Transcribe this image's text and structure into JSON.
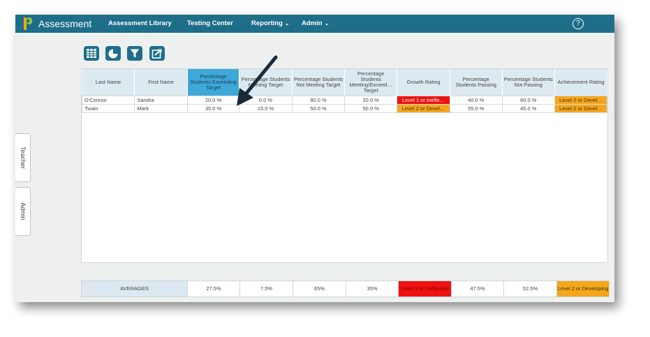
{
  "app": {
    "name": "Assessment"
  },
  "nav": [
    {
      "label": "Assessment Library",
      "has_menu": false
    },
    {
      "label": "Testing Center",
      "has_menu": false
    },
    {
      "label": "Reporting",
      "has_menu": true
    },
    {
      "label": "Admin",
      "has_menu": true
    }
  ],
  "toolbar": {
    "buttons": [
      {
        "icon": "grid-table-icon"
      },
      {
        "icon": "pie-chart-icon"
      },
      {
        "icon": "filter-icon"
      },
      {
        "icon": "export-icon"
      }
    ]
  },
  "side_tabs": [
    "Teacher",
    "Admin"
  ],
  "table": {
    "headers": [
      "Last Name",
      "First Name",
      "Percentage Students Exceeding Target",
      "Percentage Students Meeting Target",
      "Percentage Students Not Meeting Target",
      "Percentage Students Meeting/Exceed… Target",
      "Growth Rating",
      "Percentage Students Passing",
      "Percentage Students Not Passing",
      "Achievement Rating"
    ],
    "rows": [
      [
        "O'Connor",
        "Sandra",
        "20.0 %",
        "0.0 %",
        "80.0 %",
        "20.0 %",
        "Level 1 or Ineffe…",
        "40.0 %",
        "60.0 %",
        "Level 2 or Devel…"
      ],
      [
        "Twain",
        "Mark",
        "35.0 %",
        "15.0 %",
        "50.0 %",
        "50.0 %",
        "Level 2 or Devel…",
        "55.0 %",
        "45.0 %",
        "Level 2 or Devel…"
      ]
    ],
    "row_styles": [
      [
        "",
        "",
        "num",
        "num",
        "num",
        "num",
        "red",
        "num",
        "num",
        "orange"
      ],
      [
        "",
        "",
        "num",
        "num",
        "num",
        "num",
        "orange",
        "num",
        "num",
        "orange"
      ]
    ],
    "highlighted_column": 2
  },
  "averages": {
    "label": "AVERAGES",
    "values": [
      "27.5%",
      "7.5%",
      "65%",
      "35%",
      "Level 1 or Ineffective",
      "47.5%",
      "52.5%",
      "Level 2 or Developing"
    ],
    "styles": [
      "",
      "",
      "",
      "",
      "red",
      "",
      "",
      "orange"
    ]
  },
  "colors": {
    "topbar": "#1e6e8a",
    "header_bg": "#dde9f1",
    "highlight_header": "#3ea8d8",
    "rating_red": "#ee1111",
    "rating_orange": "#f4a71c"
  }
}
